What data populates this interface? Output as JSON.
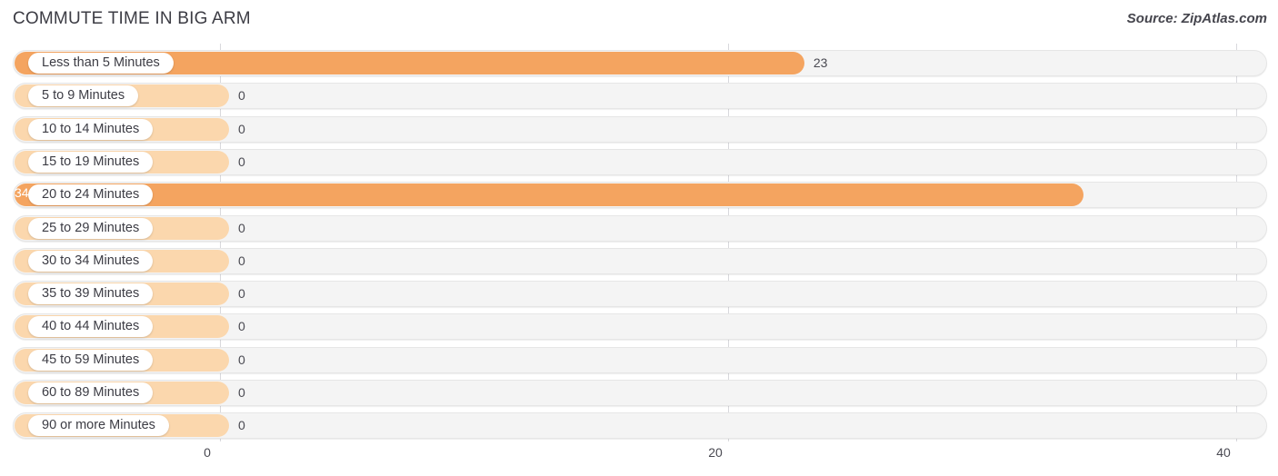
{
  "header": {
    "title": "COMMUTE TIME IN BIG ARM",
    "source": "Source: ZipAtlas.com"
  },
  "colors": {
    "bar": "#F4A460",
    "bar_zero": "#FBD7AD",
    "track": "#F4F4F4",
    "gridline": "#D9D9DD",
    "text": "#3C3C44"
  },
  "chart_data": {
    "type": "bar",
    "orientation": "horizontal",
    "title": "COMMUTE TIME IN BIG ARM",
    "xlabel": "",
    "ylabel": "",
    "xlim": [
      0,
      40
    ],
    "grid": true,
    "legend": false,
    "xticks": [
      "0",
      "20",
      "40"
    ],
    "xtick_values": [
      0,
      20,
      40
    ],
    "categories": [
      "Less than 5 Minutes",
      "5 to 9 Minutes",
      "10 to 14 Minutes",
      "15 to 19 Minutes",
      "20 to 24 Minutes",
      "25 to 29 Minutes",
      "30 to 34 Minutes",
      "35 to 39 Minutes",
      "40 to 44 Minutes",
      "45 to 59 Minutes",
      "60 to 89 Minutes",
      "90 or more Minutes"
    ],
    "values": [
      23,
      0,
      0,
      0,
      34,
      0,
      0,
      0,
      0,
      0,
      0,
      0
    ],
    "value_labels": [
      "23",
      "0",
      "0",
      "0",
      "34",
      "0",
      "0",
      "0",
      "0",
      "0",
      "0",
      "0"
    ]
  },
  "rows": [
    {
      "label": "Less than 5 Minutes",
      "value": 23,
      "value_label": "23"
    },
    {
      "label": "5 to 9 Minutes",
      "value": 0,
      "value_label": "0"
    },
    {
      "label": "10 to 14 Minutes",
      "value": 0,
      "value_label": "0"
    },
    {
      "label": "15 to 19 Minutes",
      "value": 0,
      "value_label": "0"
    },
    {
      "label": "20 to 24 Minutes",
      "value": 34,
      "value_label": "34"
    },
    {
      "label": "25 to 29 Minutes",
      "value": 0,
      "value_label": "0"
    },
    {
      "label": "30 to 34 Minutes",
      "value": 0,
      "value_label": "0"
    },
    {
      "label": "35 to 39 Minutes",
      "value": 0,
      "value_label": "0"
    },
    {
      "label": "40 to 44 Minutes",
      "value": 0,
      "value_label": "0"
    },
    {
      "label": "45 to 59 Minutes",
      "value": 0,
      "value_label": "0"
    },
    {
      "label": "60 to 89 Minutes",
      "value": 0,
      "value_label": "0"
    },
    {
      "label": "90 or more Minutes",
      "value": 0,
      "value_label": "0"
    }
  ]
}
